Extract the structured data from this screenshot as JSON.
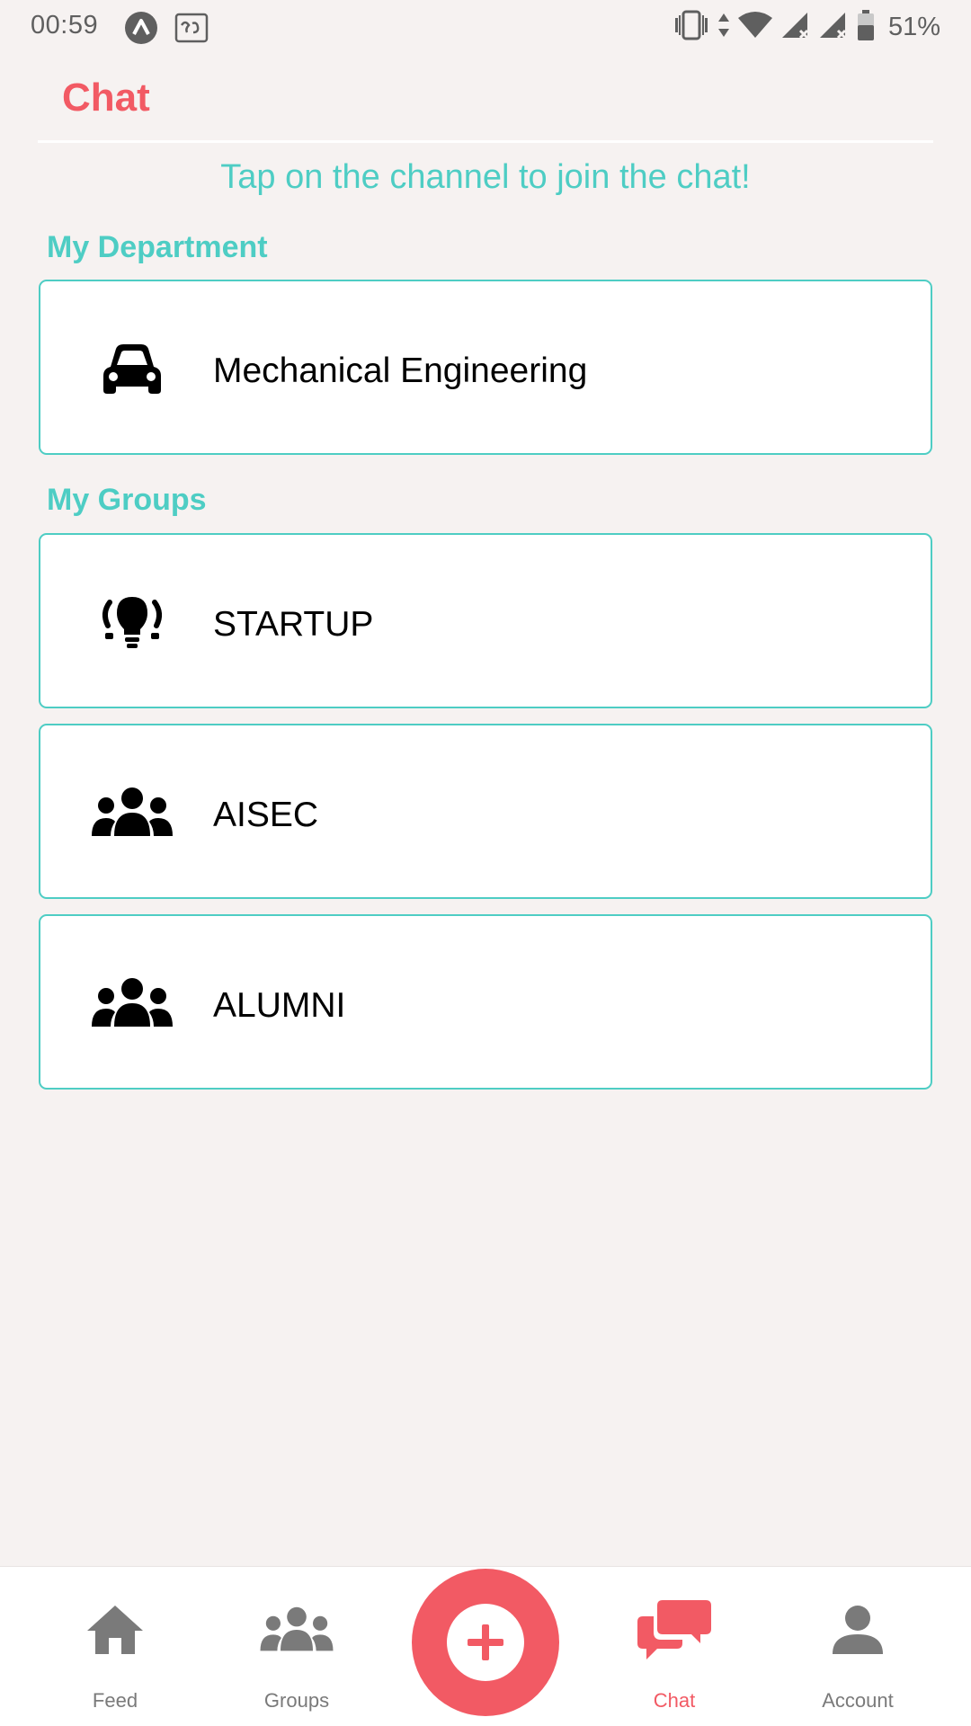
{
  "status_bar": {
    "time": "00:59",
    "battery": "51%",
    "icons": [
      "app-icon",
      "keyboard-icon",
      "vibrate-icon",
      "data-arrows-icon",
      "wifi-icon",
      "signal-icon",
      "signal-icon",
      "battery-icon"
    ]
  },
  "header": {
    "title": "Chat"
  },
  "hint": "Tap on the channel to join the chat!",
  "sections": {
    "department": {
      "title": "My Department",
      "channels": [
        {
          "label": "Mechanical Engineering",
          "icon": "car-icon"
        }
      ]
    },
    "groups": {
      "title": "My Groups",
      "channels": [
        {
          "label": "STARTUP",
          "icon": "lightbulb-icon"
        },
        {
          "label": "AISEC",
          "icon": "users-icon"
        },
        {
          "label": "ALUMNI",
          "icon": "users-icon"
        }
      ]
    }
  },
  "bottom_nav": {
    "items": [
      {
        "label": "Feed",
        "icon": "home-icon",
        "active": false
      },
      {
        "label": "Groups",
        "icon": "users-icon",
        "active": false
      },
      {
        "label": "Chat",
        "icon": "chat-icon",
        "active": true
      },
      {
        "label": "Account",
        "icon": "user-icon",
        "active": false
      }
    ],
    "fab_icon": "plus-icon"
  },
  "colors": {
    "accent": "#f25a64",
    "teal": "#4ecdc4",
    "background": "#f6f2f1",
    "inactive": "#7a7a7a"
  }
}
